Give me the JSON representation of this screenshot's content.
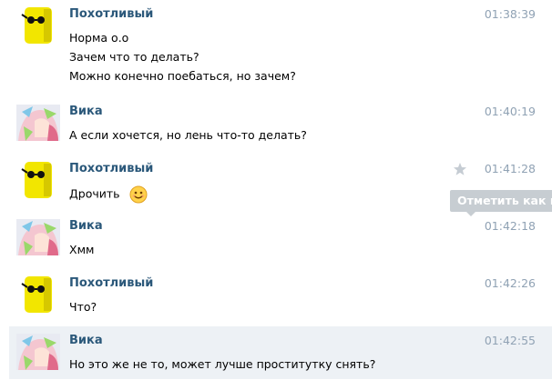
{
  "messages": [
    {
      "author": "Похотливый",
      "avatar": "yellow-sunglasses-avatar",
      "time": "01:38:39",
      "lines": [
        "Норма о.о",
        "Зачем что то делать?",
        "Можно конечно поебаться, но зачем?"
      ]
    },
    {
      "author": "Вика",
      "avatar": "anime-girl-avatar",
      "time": "01:40:19",
      "lines": [
        "А если хочется, но лень что-то делать?"
      ]
    },
    {
      "author": "Похотливый",
      "avatar": "yellow-sunglasses-avatar",
      "time": "01:41:28",
      "lines": [
        "Дрочить"
      ],
      "emoji": "smiley"
    },
    {
      "author": "Вика",
      "avatar": "anime-girl-avatar",
      "time": "01:42:18",
      "lines": [
        "Хмм"
      ]
    },
    {
      "author": "Похотливый",
      "avatar": "yellow-sunglasses-avatar",
      "time": "01:42:26",
      "lines": [
        "Что?"
      ]
    },
    {
      "author": "Вика",
      "avatar": "anime-girl-avatar",
      "time": "01:42:55",
      "lines": [
        "Но это же не то, может лучше проститутку снять?"
      ]
    }
  ],
  "tooltip": {
    "label": "Отметить как важное",
    "icon": "star-icon"
  },
  "colors": {
    "author": "#2b587a",
    "time": "#90a2b4",
    "highlight_bg": "#edf1f5",
    "tooltip_bg": "#c7cdd2"
  }
}
